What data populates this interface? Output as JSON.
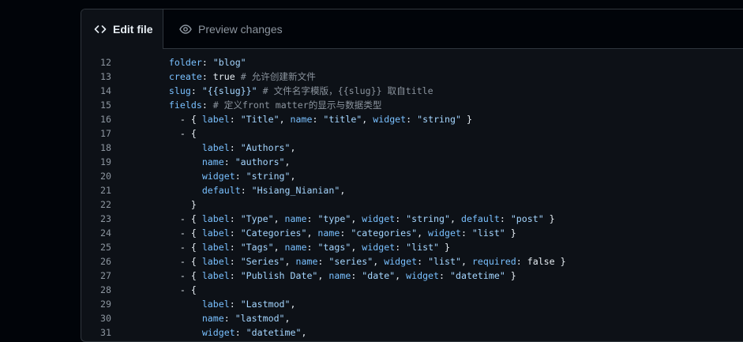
{
  "tabs": {
    "edit_label": "Edit file",
    "preview_label": "Preview changes"
  },
  "code_lines": [
    {
      "n": "12",
      "tokens": [
        [
          "sp",
          "    "
        ],
        [
          "key",
          "folder"
        ],
        [
          "p",
          ": "
        ],
        [
          "str",
          "\"blog\""
        ]
      ]
    },
    {
      "n": "13",
      "tokens": [
        [
          "sp",
          "    "
        ],
        [
          "key",
          "create"
        ],
        [
          "p",
          ": true "
        ],
        [
          "com",
          "# 允许创建新文件"
        ]
      ]
    },
    {
      "n": "14",
      "tokens": [
        [
          "sp",
          "    "
        ],
        [
          "key",
          "slug"
        ],
        [
          "p",
          ": "
        ],
        [
          "str",
          "\"{{slug}}\""
        ],
        [
          "p",
          " "
        ],
        [
          "com",
          "# 文件名字模版，{{slug}} 取自title"
        ]
      ]
    },
    {
      "n": "15",
      "tokens": [
        [
          "sp",
          "    "
        ],
        [
          "key",
          "fields"
        ],
        [
          "p",
          ": "
        ],
        [
          "com",
          "# 定义front matter的显示与数据类型"
        ]
      ]
    },
    {
      "n": "16",
      "tokens": [
        [
          "sp",
          "      "
        ],
        [
          "p",
          "- { "
        ],
        [
          "key",
          "label"
        ],
        [
          "p",
          ": "
        ],
        [
          "str",
          "\"Title\""
        ],
        [
          "p",
          ", "
        ],
        [
          "key",
          "name"
        ],
        [
          "p",
          ": "
        ],
        [
          "str",
          "\"title\""
        ],
        [
          "p",
          ", "
        ],
        [
          "key",
          "widget"
        ],
        [
          "p",
          ": "
        ],
        [
          "str",
          "\"string\""
        ],
        [
          "p",
          " }"
        ]
      ]
    },
    {
      "n": "17",
      "tokens": [
        [
          "sp",
          "      "
        ],
        [
          "p",
          "- {"
        ]
      ]
    },
    {
      "n": "18",
      "tokens": [
        [
          "sp",
          "          "
        ],
        [
          "key",
          "label"
        ],
        [
          "p",
          ": "
        ],
        [
          "str",
          "\"Authors\""
        ],
        [
          "p",
          ","
        ]
      ]
    },
    {
      "n": "19",
      "tokens": [
        [
          "sp",
          "          "
        ],
        [
          "key",
          "name"
        ],
        [
          "p",
          ": "
        ],
        [
          "str",
          "\"authors\""
        ],
        [
          "p",
          ","
        ]
      ]
    },
    {
      "n": "20",
      "tokens": [
        [
          "sp",
          "          "
        ],
        [
          "key",
          "widget"
        ],
        [
          "p",
          ": "
        ],
        [
          "str",
          "\"string\""
        ],
        [
          "p",
          ","
        ]
      ]
    },
    {
      "n": "21",
      "tokens": [
        [
          "sp",
          "          "
        ],
        [
          "key",
          "default"
        ],
        [
          "p",
          ": "
        ],
        [
          "str",
          "\"Hsiang_Nianian\""
        ],
        [
          "p",
          ","
        ]
      ]
    },
    {
      "n": "22",
      "tokens": [
        [
          "sp",
          "        "
        ],
        [
          "p",
          "}"
        ]
      ]
    },
    {
      "n": "23",
      "tokens": [
        [
          "sp",
          "      "
        ],
        [
          "p",
          "- { "
        ],
        [
          "key",
          "label"
        ],
        [
          "p",
          ": "
        ],
        [
          "str",
          "\"Type\""
        ],
        [
          "p",
          ", "
        ],
        [
          "key",
          "name"
        ],
        [
          "p",
          ": "
        ],
        [
          "str",
          "\"type\""
        ],
        [
          "p",
          ", "
        ],
        [
          "key",
          "widget"
        ],
        [
          "p",
          ": "
        ],
        [
          "str",
          "\"string\""
        ],
        [
          "p",
          ", "
        ],
        [
          "key",
          "default"
        ],
        [
          "p",
          ": "
        ],
        [
          "str",
          "\"post\""
        ],
        [
          "p",
          " }"
        ]
      ]
    },
    {
      "n": "24",
      "tokens": [
        [
          "sp",
          "      "
        ],
        [
          "p",
          "- { "
        ],
        [
          "key",
          "label"
        ],
        [
          "p",
          ": "
        ],
        [
          "str",
          "\"Categories\""
        ],
        [
          "p",
          ", "
        ],
        [
          "key",
          "name"
        ],
        [
          "p",
          ": "
        ],
        [
          "str",
          "\"categories\""
        ],
        [
          "p",
          ", "
        ],
        [
          "key",
          "widget"
        ],
        [
          "p",
          ": "
        ],
        [
          "str",
          "\"list\""
        ],
        [
          "p",
          " }"
        ]
      ]
    },
    {
      "n": "25",
      "tokens": [
        [
          "sp",
          "      "
        ],
        [
          "p",
          "- { "
        ],
        [
          "key",
          "label"
        ],
        [
          "p",
          ": "
        ],
        [
          "str",
          "\"Tags\""
        ],
        [
          "p",
          ", "
        ],
        [
          "key",
          "name"
        ],
        [
          "p",
          ": "
        ],
        [
          "str",
          "\"tags\""
        ],
        [
          "p",
          ", "
        ],
        [
          "key",
          "widget"
        ],
        [
          "p",
          ": "
        ],
        [
          "str",
          "\"list\""
        ],
        [
          "p",
          " }"
        ]
      ]
    },
    {
      "n": "26",
      "tokens": [
        [
          "sp",
          "      "
        ],
        [
          "p",
          "- { "
        ],
        [
          "key",
          "label"
        ],
        [
          "p",
          ": "
        ],
        [
          "str",
          "\"Series\""
        ],
        [
          "p",
          ", "
        ],
        [
          "key",
          "name"
        ],
        [
          "p",
          ": "
        ],
        [
          "str",
          "\"series\""
        ],
        [
          "p",
          ", "
        ],
        [
          "key",
          "widget"
        ],
        [
          "p",
          ": "
        ],
        [
          "str",
          "\"list\""
        ],
        [
          "p",
          ", "
        ],
        [
          "key",
          "required"
        ],
        [
          "p",
          ": false }"
        ]
      ]
    },
    {
      "n": "27",
      "tokens": [
        [
          "sp",
          "      "
        ],
        [
          "p",
          "- { "
        ],
        [
          "key",
          "label"
        ],
        [
          "p",
          ": "
        ],
        [
          "str",
          "\"Publish Date\""
        ],
        [
          "p",
          ", "
        ],
        [
          "key",
          "name"
        ],
        [
          "p",
          ": "
        ],
        [
          "str",
          "\"date\""
        ],
        [
          "p",
          ", "
        ],
        [
          "key",
          "widget"
        ],
        [
          "p",
          ": "
        ],
        [
          "str",
          "\"datetime\""
        ],
        [
          "p",
          " }"
        ]
      ]
    },
    {
      "n": "28",
      "tokens": [
        [
          "sp",
          "      "
        ],
        [
          "p",
          "- {"
        ]
      ]
    },
    {
      "n": "29",
      "tokens": [
        [
          "sp",
          "          "
        ],
        [
          "key",
          "label"
        ],
        [
          "p",
          ": "
        ],
        [
          "str",
          "\"Lastmod\""
        ],
        [
          "p",
          ","
        ]
      ]
    },
    {
      "n": "30",
      "tokens": [
        [
          "sp",
          "          "
        ],
        [
          "key",
          "name"
        ],
        [
          "p",
          ": "
        ],
        [
          "str",
          "\"lastmod\""
        ],
        [
          "p",
          ","
        ]
      ]
    },
    {
      "n": "31",
      "tokens": [
        [
          "sp",
          "          "
        ],
        [
          "key",
          "widget"
        ],
        [
          "p",
          ": "
        ],
        [
          "str",
          "\"datetime\""
        ],
        [
          "p",
          ","
        ]
      ]
    }
  ]
}
